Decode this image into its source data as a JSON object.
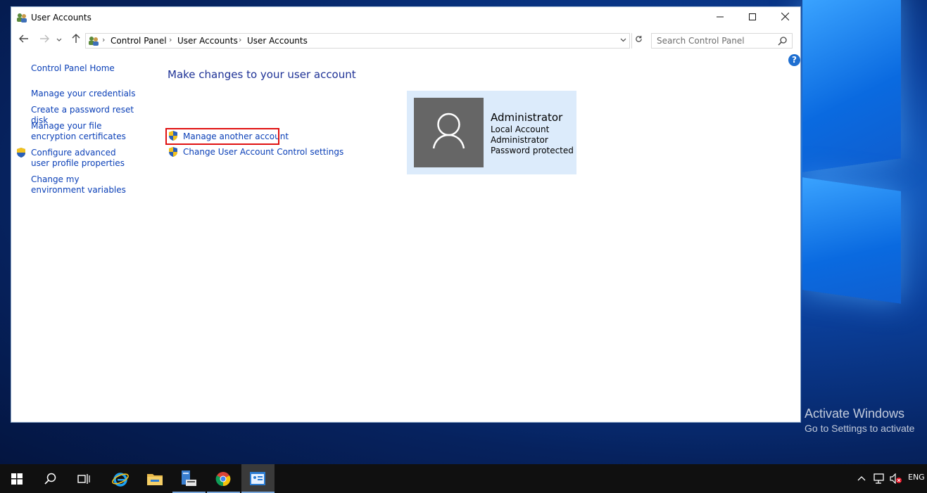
{
  "window": {
    "title": "User Accounts",
    "controls": {
      "minimize": "—",
      "maximize": "☐",
      "close": "✕"
    }
  },
  "address_bar": {
    "breadcrumbs": [
      "Control Panel",
      "User Accounts",
      "User Accounts"
    ],
    "search_placeholder": "Search Control Panel"
  },
  "left_nav": {
    "home": "Control Panel Home",
    "items": [
      "Manage your credentials",
      "Create a password reset disk",
      "Manage your file encryption certificates",
      "Configure advanced user profile properties",
      "Change my environment variables"
    ]
  },
  "main": {
    "heading": "Make changes to your user account",
    "tasks": [
      "Manage another account",
      "Change User Account Control settings"
    ],
    "highlighted_task": "Manage another account"
  },
  "account": {
    "name": "Administrator",
    "details": [
      "Local Account",
      "Administrator",
      "Password protected"
    ]
  },
  "watermark": {
    "line1": "Activate Windows",
    "line2": "Go to Settings to activate"
  },
  "taskbar": {
    "apps": [
      "start-icon",
      "search-icon",
      "task-view-icon",
      "internet-explorer-icon",
      "file-explorer-icon",
      "server-manager-icon",
      "chrome-icon",
      "control-panel-icon"
    ],
    "tray_language": "ENG"
  },
  "colors": {
    "link": "#0a3fb7",
    "heading": "#1e3296",
    "highlight": "#e01010",
    "card_bg": "#dcebfb",
    "taskbar": "#101010"
  }
}
